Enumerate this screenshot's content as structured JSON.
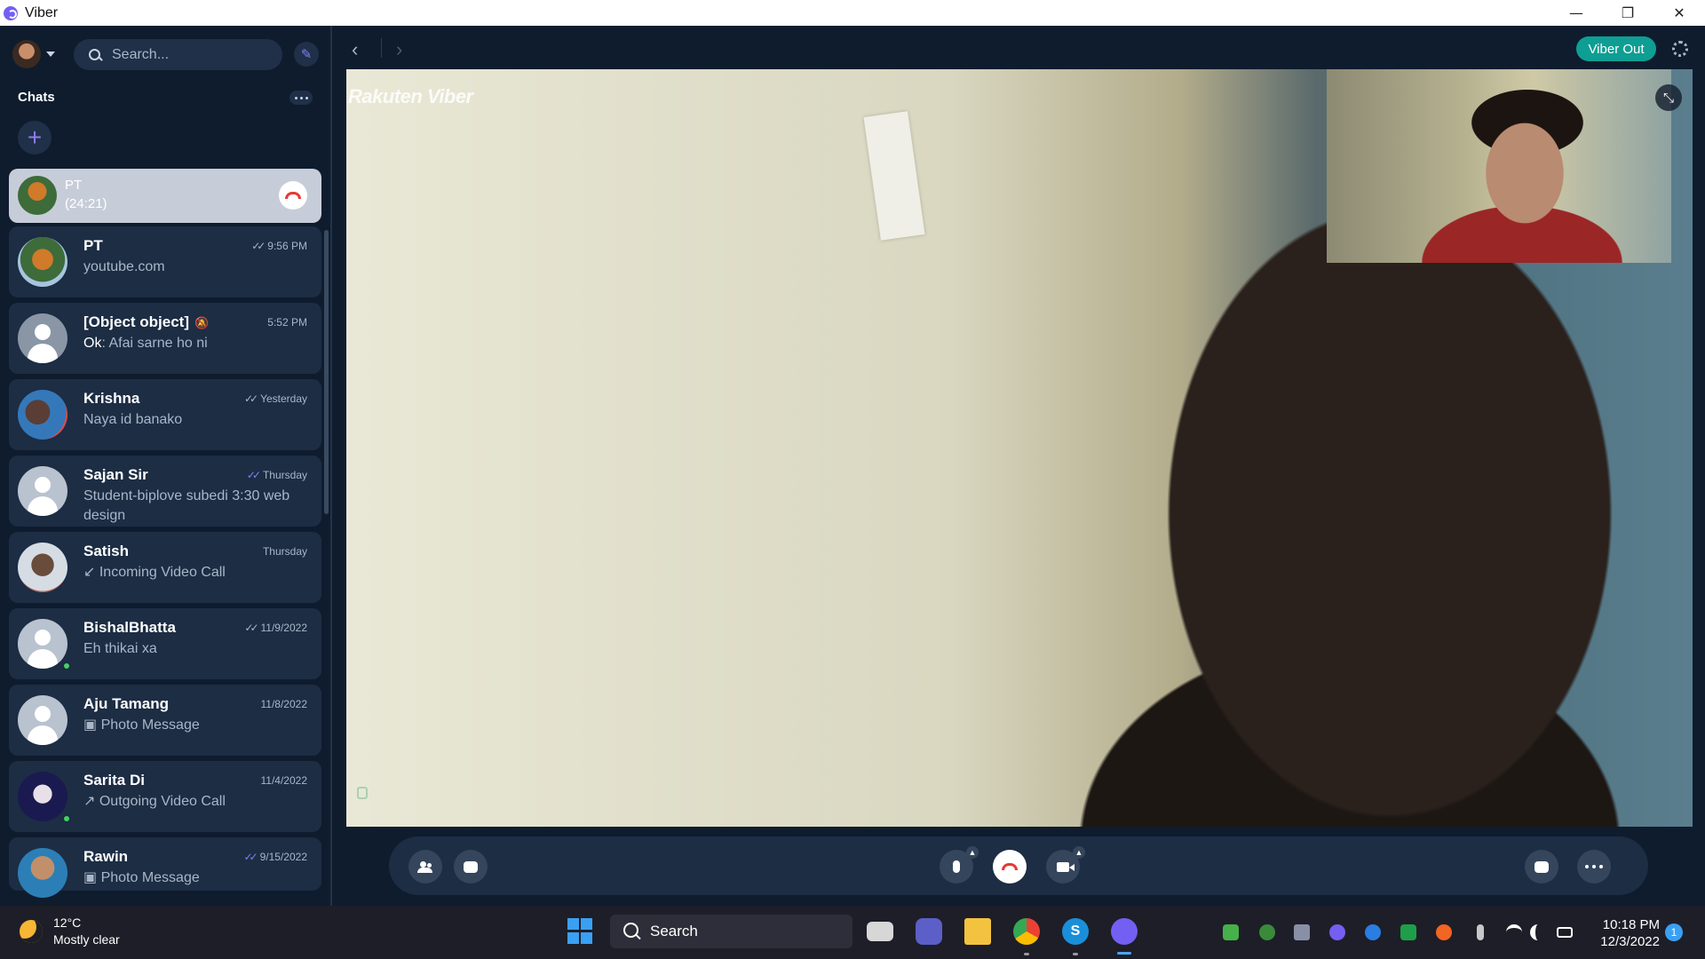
{
  "window": {
    "title": "Viber",
    "minimize": "—",
    "maximize": "❐",
    "close": "✕"
  },
  "sidebar": {
    "search_placeholder": "Search...",
    "section_title": "Chats",
    "active_call": {
      "name": "PT",
      "duration": "(24:21)"
    },
    "chats": [
      {
        "name": "PT",
        "preview": "youtube.com",
        "time": "9:56 PM",
        "status": "delivered"
      },
      {
        "name": "[Object object]",
        "preview_sender": "Ok",
        "preview": ": Afai sarne ho ni",
        "time": "5:52 PM",
        "muted": true
      },
      {
        "name": "Krishna",
        "preview": "Naya id banako",
        "time": "Yesterday",
        "status": "delivered"
      },
      {
        "name": "Sajan Sir",
        "preview": "Student-biplove subedi 3:30 web design",
        "time": "Thursday",
        "status": "read"
      },
      {
        "name": "Satish",
        "preview": "↙ Incoming Video Call",
        "time": "Thursday"
      },
      {
        "name": "BishalBhatta",
        "preview": "Eh thikai xa",
        "time": "11/9/2022",
        "status": "delivered",
        "online": true
      },
      {
        "name": "Aju Tamang",
        "preview": "Photo Message",
        "time": "11/8/2022"
      },
      {
        "name": "Sarita Di",
        "preview": "↗ Outgoing Video Call",
        "time": "11/4/2022",
        "online": true
      },
      {
        "name": "Rawin",
        "preview": "Photo Message",
        "time": "9/15/2022",
        "status": "read"
      }
    ]
  },
  "main": {
    "viber_out": "Viber Out",
    "watermark": "Rakuten Viber",
    "controls": [
      "add-participant",
      "chat",
      "microphone",
      "end-call",
      "camera",
      "screen-share",
      "more"
    ]
  },
  "taskbar": {
    "weather_temp": "12°C",
    "weather_text": "Mostly clear",
    "search_label": "Search",
    "time": "10:18 PM",
    "date": "12/3/2022",
    "notifications": "1"
  },
  "colors": {
    "accent": "#7360f2",
    "viber_out": "#0f9e93",
    "end_call": "#e53935",
    "online": "#46d160"
  }
}
